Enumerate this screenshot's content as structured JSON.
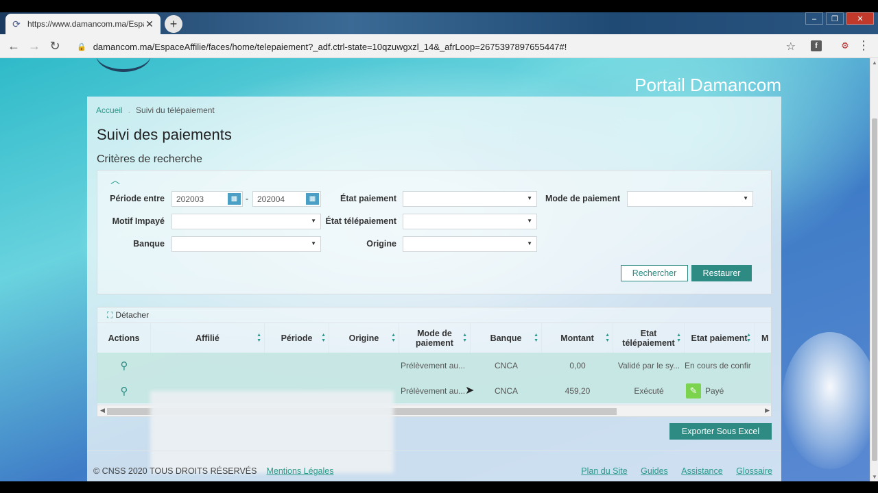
{
  "browser": {
    "tab_title": "https://www.damancom.ma/EspaceAffilie",
    "tab_close": "✕",
    "new_tab": "+",
    "url": "damancom.ma/EspaceAffilie/faces/home/telepaiement?_adf.ctrl-state=10qzuwgxzl_14&_afrLoop=2675397897655447#!",
    "window_controls": [
      "–",
      "❐",
      "✕"
    ]
  },
  "page": {
    "portal_title": "Portail Damancom",
    "breadcrumb": {
      "home": "Accueil",
      "current": "Suivi du télépaiement"
    },
    "title": "Suivi des paiements",
    "criteria_title": "Critères de recherche"
  },
  "criteria": {
    "periode_label": "Période entre",
    "periode_from": "202003",
    "periode_to": "202004",
    "periode_sep": "-",
    "etat_paiement_label": "État paiement",
    "mode_paiement_label": "Mode de paiement",
    "motif_label": "Motif Impayé",
    "etat_telepaiement_label": "État télépaiement",
    "banque_label": "Banque",
    "origine_label": "Origine",
    "search_button": "Rechercher",
    "reset_button": "Restaurer"
  },
  "grid": {
    "detach": "Détacher",
    "columns": [
      "Actions",
      "Affilié",
      "Période",
      "Origine",
      "Mode de paiement",
      "Banque",
      "Montant",
      "Etat télépaiement",
      "Etat paiement",
      "M"
    ],
    "rows": [
      {
        "mode": "Prélèvement au...",
        "banque": "CNCA",
        "montant": "0,00",
        "etat_tele": "Validé par le sy...",
        "etat_paiement": "En cours de confir"
      },
      {
        "mode": "Prélèvement au...",
        "banque": "CNCA",
        "montant": "459,20",
        "etat_tele": "Exécuté",
        "etat_paiement": "Payé"
      }
    ]
  },
  "export_button": "Exporter Sous Excel",
  "footer": {
    "copyright": "© CNSS 2020 TOUS DROITS RÉSERVÉS",
    "legal": "Mentions Légales",
    "links": [
      "Plan du Site",
      "Guides",
      "Assistance",
      "Glossaire"
    ]
  },
  "colors": {
    "accent": "#2e8b84",
    "link": "#2a9a8a"
  }
}
